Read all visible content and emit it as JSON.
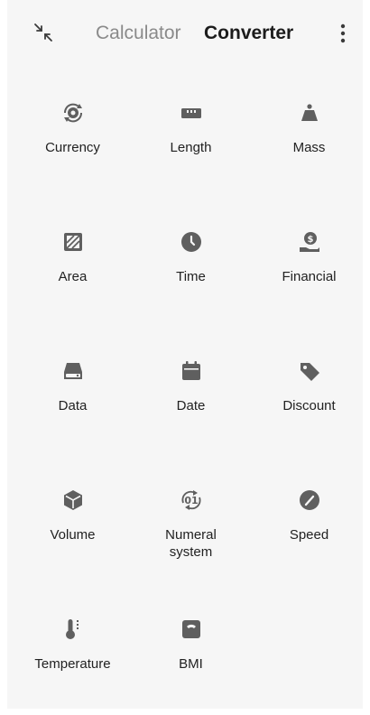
{
  "header": {
    "tabs": [
      {
        "label": "Calculator",
        "active": false
      },
      {
        "label": "Converter",
        "active": true
      }
    ],
    "collapse_icon": "collapse-arrows-icon",
    "menu_icon": "more-vertical-icon"
  },
  "colors": {
    "background": "#f6f6f6",
    "icon": "#5f5f5f",
    "active_tab": "#1c1c1c",
    "inactive_tab": "#8a8a8a"
  },
  "converters": [
    {
      "label": "Currency",
      "icon": "currency-exchange-icon"
    },
    {
      "label": "Length",
      "icon": "ruler-icon"
    },
    {
      "label": "Mass",
      "icon": "weight-icon"
    },
    {
      "label": "Area",
      "icon": "area-icon"
    },
    {
      "label": "Time",
      "icon": "clock-icon"
    },
    {
      "label": "Financial",
      "icon": "money-hand-icon"
    },
    {
      "label": "Data",
      "icon": "storage-drive-icon"
    },
    {
      "label": "Date",
      "icon": "calendar-icon"
    },
    {
      "label": "Discount",
      "icon": "price-tag-icon"
    },
    {
      "label": "Volume",
      "icon": "cube-icon"
    },
    {
      "label": "Numeral\nsystem",
      "icon": "numeral-system-icon"
    },
    {
      "label": "Speed",
      "icon": "speedometer-icon"
    },
    {
      "label": "Temperature",
      "icon": "thermometer-icon"
    },
    {
      "label": "BMI",
      "icon": "scale-icon"
    }
  ]
}
